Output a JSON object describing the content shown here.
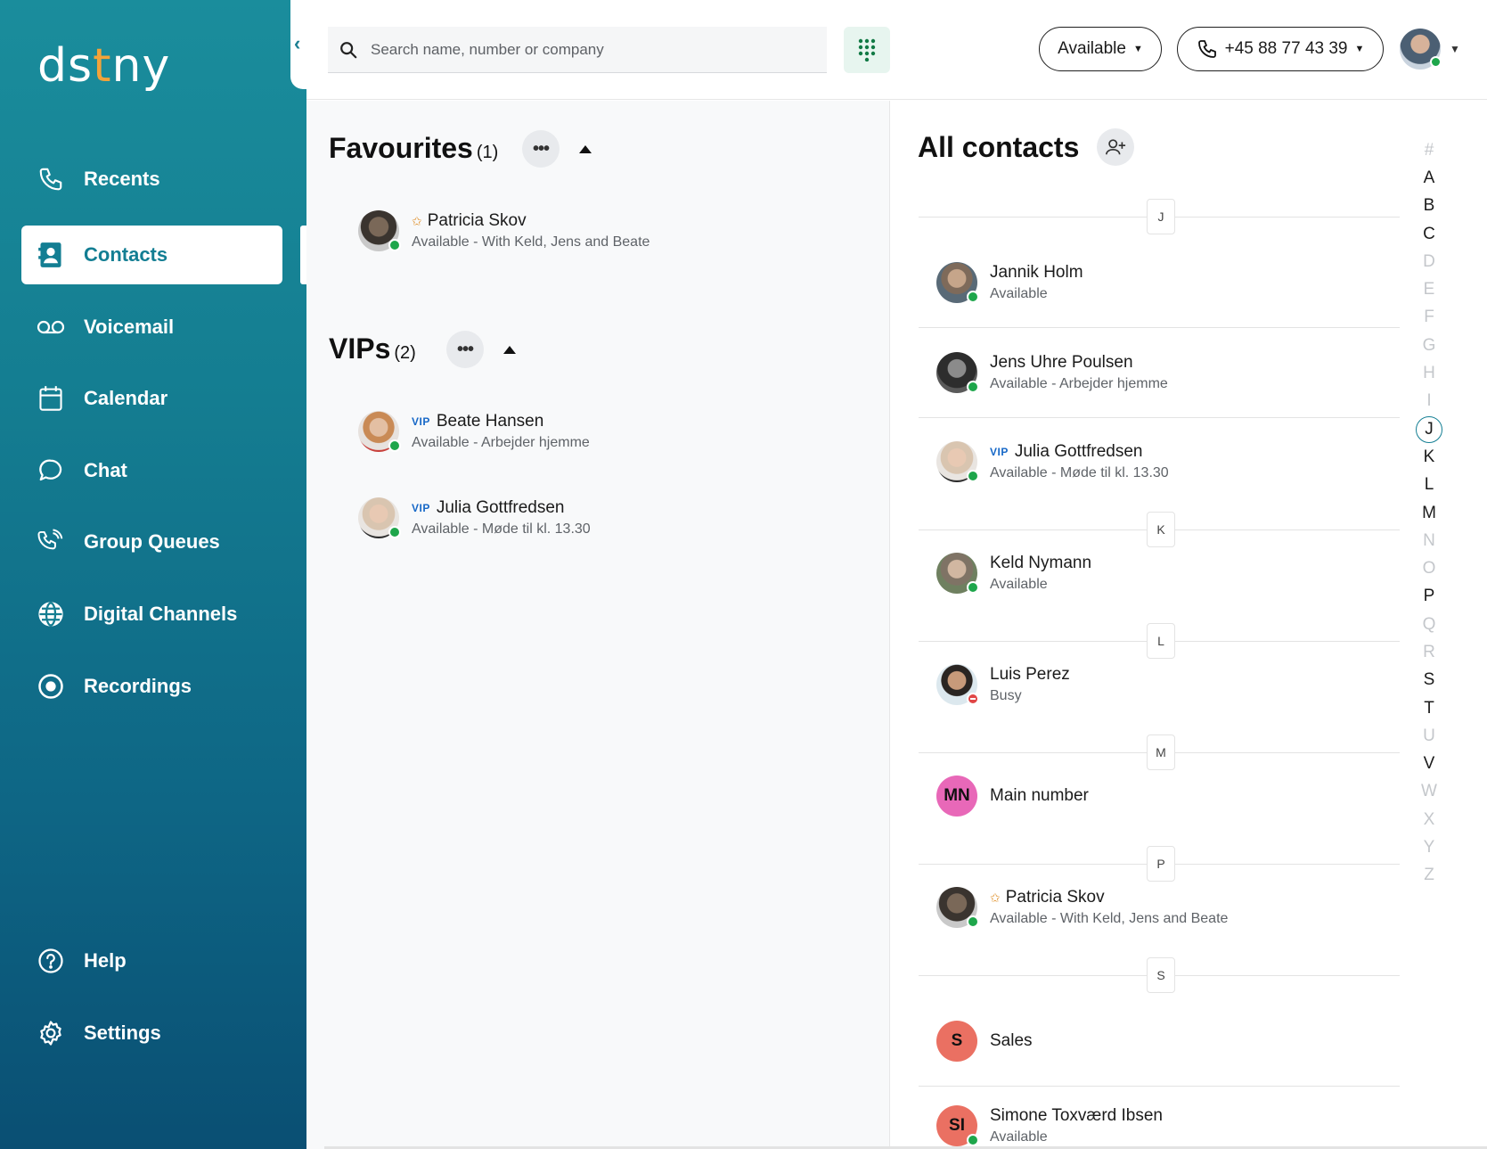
{
  "app": {
    "logo": {
      "pre": "ds",
      "dot": "t",
      "post": "ny"
    },
    "nav": [
      {
        "label": "Recents",
        "icon": "phone-icon",
        "active": false
      },
      {
        "label": "Contacts",
        "icon": "contacts-icon",
        "active": true
      },
      {
        "label": "Voicemail",
        "icon": "voicemail-icon",
        "active": false
      },
      {
        "label": "Calendar",
        "icon": "calendar-icon",
        "active": false
      },
      {
        "label": "Chat",
        "icon": "chat-icon",
        "active": false
      },
      {
        "label": "Group Queues",
        "icon": "group-queues-icon",
        "active": false
      },
      {
        "label": "Digital Channels",
        "icon": "globe-icon",
        "active": false
      },
      {
        "label": "Recordings",
        "icon": "record-icon",
        "active": false
      }
    ],
    "nav_bottom": [
      {
        "label": "Help",
        "icon": "help-icon"
      },
      {
        "label": "Settings",
        "icon": "gear-icon"
      }
    ]
  },
  "topbar": {
    "search_placeholder": "Search name, number or company",
    "status": "Available",
    "phone": "+45 88 77 43 39",
    "colors": {
      "accent": "#137e93",
      "online": "#1ea64b",
      "busy": "#e04646",
      "vip": "#1768c7"
    }
  },
  "favourites": {
    "title": "Favourites",
    "count": "(1)",
    "items": [
      {
        "name": "Patricia Skov",
        "status": "Available - With Keld, Jens and Beate",
        "star": "✩",
        "presence": "online"
      }
    ]
  },
  "vips": {
    "title": "VIPs",
    "count": "(2)",
    "items": [
      {
        "badge": "VIP",
        "name": "Beate Hansen",
        "status": "Available - Arbejder hjemme",
        "presence": "online"
      },
      {
        "badge": "VIP",
        "name": "Julia Gottfredsen",
        "status": "Available - Møde til kl. 13.30",
        "presence": "online"
      }
    ]
  },
  "all_contacts": {
    "title": "All contacts",
    "letters": [
      "J",
      "K",
      "L",
      "M",
      "P",
      "S"
    ],
    "contacts": [
      {
        "name": "Jannik Holm",
        "status": "Available",
        "presence": "online"
      },
      {
        "name": "Jens Uhre Poulsen",
        "status": "Available - Arbejder hjemme",
        "presence": "online"
      },
      {
        "badge": "VIP",
        "name": "Julia Gottfredsen",
        "status": "Available - Møde til kl. 13.30",
        "presence": "online"
      },
      {
        "name": "Keld Nymann",
        "status": "Available",
        "presence": "online"
      },
      {
        "name": "Luis Perez",
        "status": "Busy",
        "presence": "busy"
      },
      {
        "initials": "MN",
        "name": "Main number",
        "color": "#e868b8"
      },
      {
        "star": "✩",
        "name": "Patricia Skov",
        "status": "Available - With Keld, Jens and Beate",
        "presence": "online"
      },
      {
        "initials": "S",
        "name": "Sales",
        "color": "#ea7062"
      },
      {
        "initials": "SI",
        "name": "Simone Toxværd Ibsen",
        "status": "Available",
        "presence": "online",
        "color": "#ea7062"
      }
    ],
    "index": {
      "letters": [
        "#",
        "A",
        "B",
        "C",
        "D",
        "E",
        "F",
        "G",
        "H",
        "I",
        "J",
        "K",
        "L",
        "M",
        "N",
        "O",
        "P",
        "Q",
        "R",
        "S",
        "T",
        "U",
        "V",
        "W",
        "X",
        "Y",
        "Z"
      ],
      "enabled": [
        "A",
        "B",
        "C",
        "J",
        "K",
        "L",
        "M",
        "P",
        "S",
        "T",
        "V"
      ],
      "current": "J"
    }
  }
}
